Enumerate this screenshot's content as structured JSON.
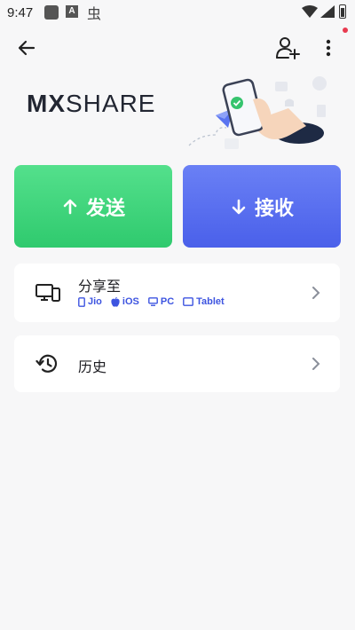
{
  "status_bar": {
    "time": "9:47",
    "a_label": "A",
    "glyph": "虫"
  },
  "logo": {
    "mx": "MX",
    "share": "SHARE"
  },
  "buttons": {
    "send": "发送",
    "receive": "接收"
  },
  "share_card": {
    "title": "分享至",
    "platforms": [
      {
        "label": "Jio",
        "icon": "phone-icon"
      },
      {
        "label": "iOS",
        "icon": "apple-icon"
      },
      {
        "label": "PC",
        "icon": "monitor-icon"
      },
      {
        "label": "Tablet",
        "icon": "tablet-icon"
      }
    ]
  },
  "history_card": {
    "title": "历史"
  },
  "colors": {
    "send": "#36d178",
    "receive": "#5068ef",
    "accent": "#3d54e0",
    "notify": "#e83a4f"
  }
}
